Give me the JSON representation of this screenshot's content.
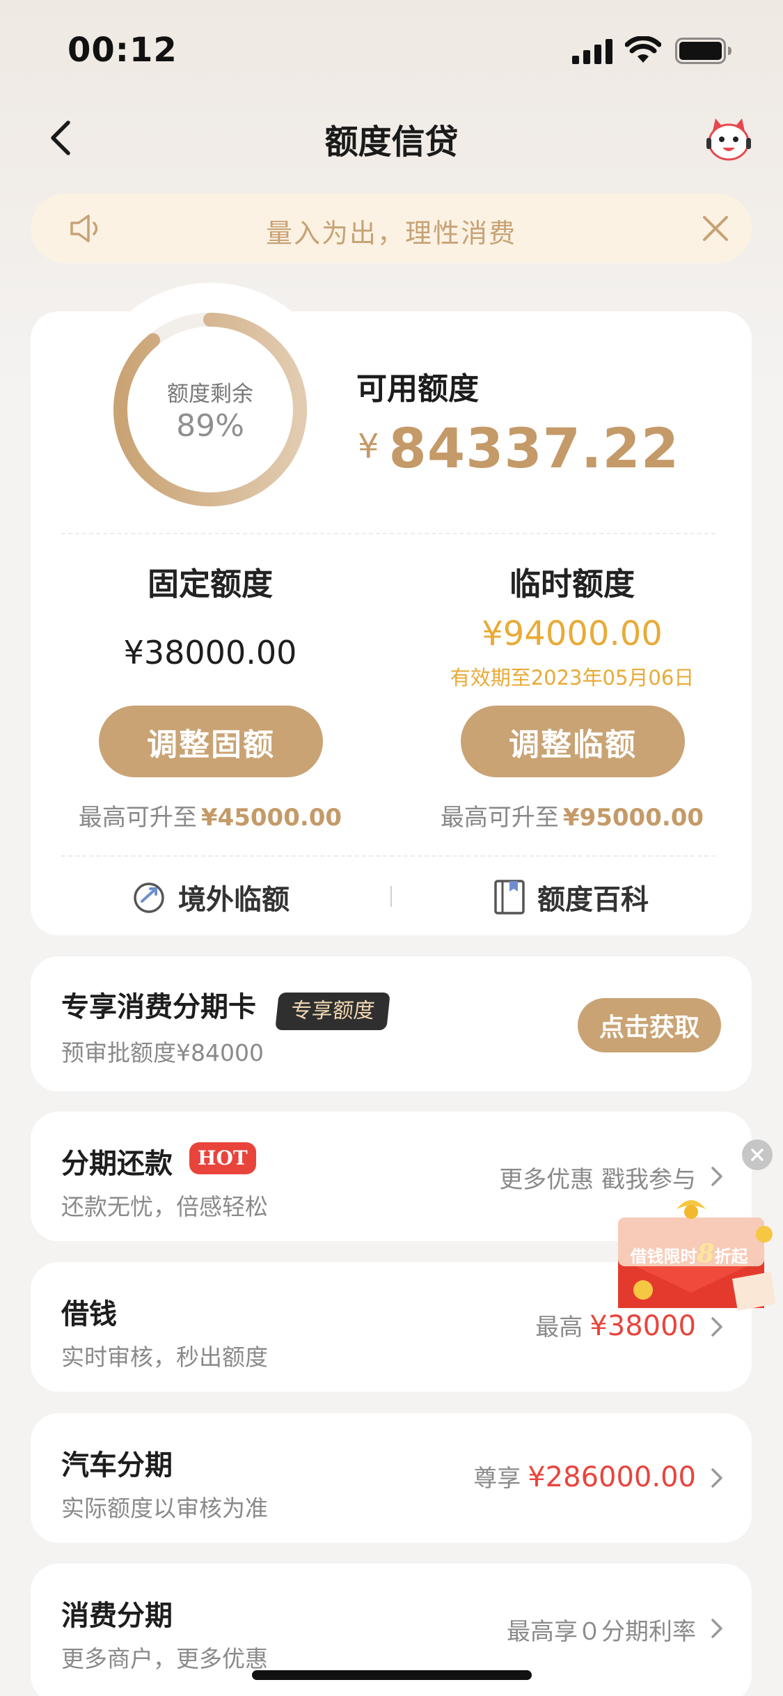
{
  "status_bar": {
    "time": "00:12"
  },
  "nav": {
    "title": "额度信贷"
  },
  "notice": {
    "text": "量入为出，理性消费"
  },
  "credit": {
    "ring_label": "额度剩余",
    "ring_percent": "89%",
    "ring_fraction": 0.89,
    "available_label": "可用额度",
    "available_currency": "¥",
    "available_amount": "84337.22",
    "fixed": {
      "title": "固定额度",
      "amount": "¥38000.00",
      "button": "调整固额",
      "max_prefix": "最高可升至",
      "max_value": "¥45000.00"
    },
    "temporary": {
      "title": "临时额度",
      "amount": "¥94000.00",
      "expiry": "有效期至2023年05月06日",
      "button": "调整临额",
      "max_prefix": "最高可升至",
      "max_value": "¥95000.00"
    },
    "links": {
      "overseas": "境外临额",
      "encyclopedia": "额度百科"
    }
  },
  "installment_card": {
    "title": "专享消费分期卡",
    "tag": "专享额度",
    "subtitle": "预审批额度¥84000",
    "button": "点击获取"
  },
  "services": [
    {
      "title": "分期还款",
      "badge": "HOT",
      "subtitle": "还款无忧，倍感轻松",
      "right_text": "更多优惠 戳我参与",
      "right_value": ""
    },
    {
      "title": "借钱",
      "subtitle": "实时审核，秒出额度",
      "right_text": "最高",
      "right_value": "¥38000"
    },
    {
      "title": "汽车分期",
      "subtitle": "实际额度以审核为准",
      "right_text": "尊享",
      "right_value": "¥286000.00"
    },
    {
      "title": "消费分期",
      "subtitle": "更多商户，更多优惠",
      "right_text": "最高享０分期利率",
      "right_value": ""
    }
  ],
  "promo": {
    "text_prefix": "借钱限时",
    "text_big": "8",
    "text_suffix": "折起"
  },
  "colors": {
    "accent": "#c9a374",
    "gold_text": "#c49a68",
    "temp_yellow": "#e9aa36",
    "hot_red": "#e9443c"
  }
}
